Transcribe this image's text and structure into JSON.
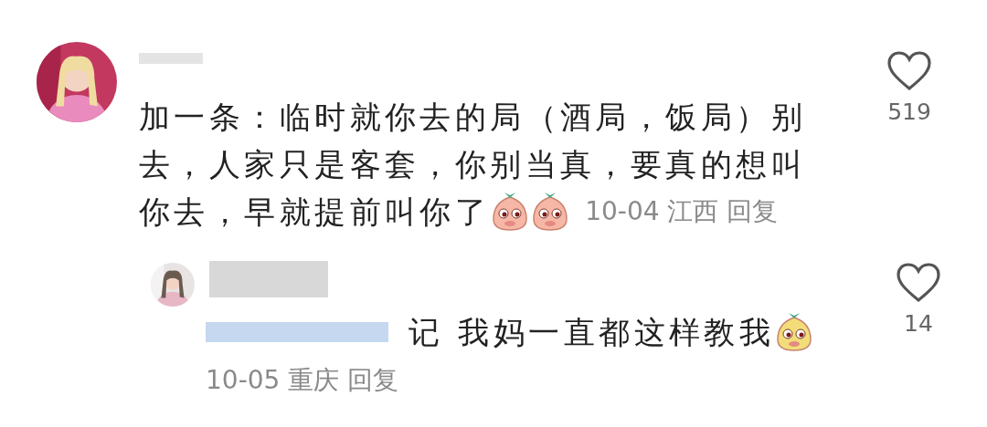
{
  "comments": [
    {
      "text_lines": [
        "加一条：临时就你去的局（酒局，饭局）别",
        "去，人家只是客套，你别当真，要真的想叫",
        "你去，早就提前叫你了"
      ],
      "emojis": [
        {
          "kind": "peach"
        },
        {
          "kind": "peach"
        }
      ],
      "date": "10-04",
      "location": "江西",
      "reply_label": "回复",
      "likes": "519",
      "liked": false,
      "replies": [
        {
          "fragment": "记",
          "text": "我妈一直都这样教我",
          "emojis": [
            {
              "kind": "pear"
            }
          ],
          "date": "10-05",
          "location": "重庆",
          "reply_label": "回复",
          "likes": "14",
          "liked": false
        }
      ]
    }
  ]
}
